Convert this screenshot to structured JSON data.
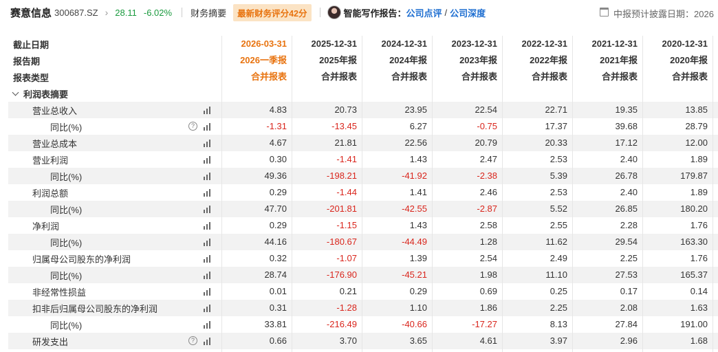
{
  "header": {
    "stock_name": "赛意信息",
    "stock_code": "300687.SZ",
    "chevron": "chevron-right-icon",
    "price": "28.11",
    "change_pct": "-6.02%",
    "fin_summary": "财务摘要",
    "score_badge": "最新财务评分42分",
    "ai_report_label": "智能写作报告：",
    "link_review": "公司点评",
    "slash": "/",
    "link_depth": "公司深度",
    "disclose_label": "中报预计披露日期：2026",
    "colors": {
      "up_green": "#1a9a3e",
      "accent_orange": "#e8730f",
      "link_blue": "#1f6fd1",
      "negative_red": "#d9251c"
    }
  },
  "table": {
    "header_rows": [
      {
        "label": "截止日期",
        "values": [
          "2026-03-31",
          "2025-12-31",
          "2024-12-31",
          "2023-12-31",
          "2022-12-31",
          "2021-12-31",
          "2020-12-31"
        ]
      },
      {
        "label": "报告期",
        "values": [
          "2026一季报",
          "2025年报",
          "2024年报",
          "2023年报",
          "2022年报",
          "2021年报",
          "2020年报"
        ]
      },
      {
        "label": "报表类型",
        "values": [
          "合并报表",
          "合并报表",
          "合并报表",
          "合并报表",
          "合并报表",
          "合并报表",
          "合并报表"
        ]
      }
    ],
    "section_title": "利润表摘要",
    "rows": [
      {
        "label": "营业总收入",
        "level": 1,
        "help": false,
        "values": [
          "4.83",
          "20.73",
          "23.95",
          "22.54",
          "22.71",
          "19.35",
          "13.85"
        ]
      },
      {
        "label": "同比(%)",
        "level": 2,
        "help": true,
        "values": [
          "-1.31",
          "-13.45",
          "6.27",
          "-0.75",
          "17.37",
          "39.68",
          "28.79"
        ]
      },
      {
        "label": "营业总成本",
        "level": 1,
        "help": false,
        "values": [
          "4.67",
          "21.81",
          "22.56",
          "20.79",
          "20.33",
          "17.12",
          "12.00"
        ]
      },
      {
        "label": "营业利润",
        "level": 1,
        "help": false,
        "values": [
          "0.30",
          "-1.41",
          "1.43",
          "2.47",
          "2.53",
          "2.40",
          "1.89"
        ]
      },
      {
        "label": "同比(%)",
        "level": 2,
        "help": false,
        "values": [
          "49.36",
          "-198.21",
          "-41.92",
          "-2.38",
          "5.39",
          "26.78",
          "179.87"
        ]
      },
      {
        "label": "利润总额",
        "level": 1,
        "help": false,
        "values": [
          "0.29",
          "-1.44",
          "1.41",
          "2.46",
          "2.53",
          "2.40",
          "1.89"
        ]
      },
      {
        "label": "同比(%)",
        "level": 2,
        "help": false,
        "values": [
          "47.70",
          "-201.81",
          "-42.55",
          "-2.87",
          "5.52",
          "26.85",
          "180.20"
        ]
      },
      {
        "label": "净利润",
        "level": 1,
        "help": false,
        "values": [
          "0.29",
          "-1.15",
          "1.43",
          "2.58",
          "2.55",
          "2.28",
          "1.76"
        ]
      },
      {
        "label": "同比(%)",
        "level": 2,
        "help": false,
        "values": [
          "44.16",
          "-180.67",
          "-44.49",
          "1.28",
          "11.62",
          "29.54",
          "163.30"
        ]
      },
      {
        "label": "归属母公司股东的净利润",
        "level": 1,
        "help": false,
        "values": [
          "0.32",
          "-1.07",
          "1.39",
          "2.54",
          "2.49",
          "2.25",
          "1.76"
        ]
      },
      {
        "label": "同比(%)",
        "level": 2,
        "help": false,
        "values": [
          "28.74",
          "-176.90",
          "-45.21",
          "1.98",
          "11.10",
          "27.53",
          "165.37"
        ]
      },
      {
        "label": "非经常性损益",
        "level": 1,
        "help": false,
        "values": [
          "0.01",
          "0.21",
          "0.29",
          "0.69",
          "0.25",
          "0.17",
          "0.14"
        ]
      },
      {
        "label": "扣非后归属母公司股东的净利润",
        "level": 1,
        "help": false,
        "values": [
          "0.31",
          "-1.28",
          "1.10",
          "1.86",
          "2.25",
          "2.08",
          "1.63"
        ]
      },
      {
        "label": "同比(%)",
        "level": 2,
        "help": false,
        "values": [
          "33.81",
          "-216.49",
          "-40.66",
          "-17.27",
          "8.13",
          "27.84",
          "191.00"
        ]
      },
      {
        "label": "研发支出",
        "level": 1,
        "help": true,
        "values": [
          "0.66",
          "3.70",
          "3.65",
          "4.61",
          "3.97",
          "2.96",
          "1.68"
        ]
      }
    ]
  }
}
